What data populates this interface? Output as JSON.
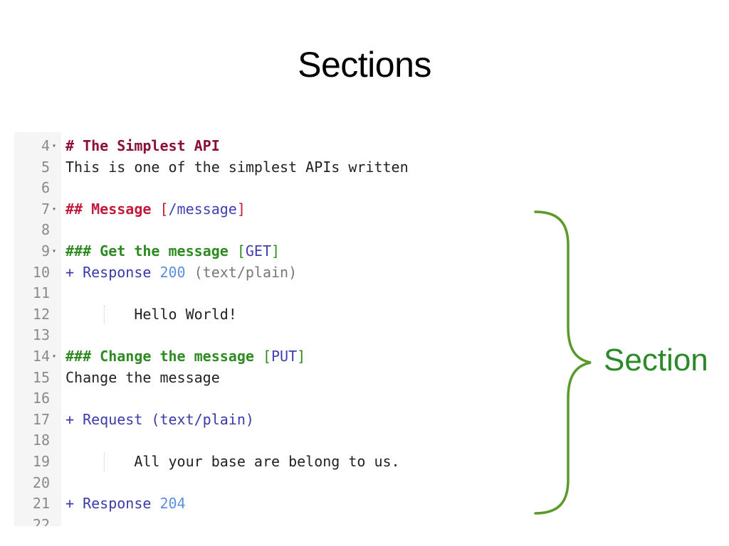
{
  "title": "Sections",
  "annotation": {
    "label": "Section",
    "brace_color": "#5a9a2a",
    "label_color": "#2a8a2a"
  },
  "lines": [
    {
      "num": "4",
      "fold": true,
      "segments": [
        {
          "t": "# The Simplest API",
          "c": "h1"
        }
      ]
    },
    {
      "num": "5",
      "fold": false,
      "segments": [
        {
          "t": "This is one of the simplest APIs written",
          "c": "plain"
        }
      ]
    },
    {
      "num": "6",
      "fold": false,
      "segments": []
    },
    {
      "num": "7",
      "fold": true,
      "segments": [
        {
          "t": "## Message ",
          "c": "h2"
        },
        {
          "t": "[",
          "c": "h2-url"
        },
        {
          "t": "/message",
          "c": "method"
        },
        {
          "t": "]",
          "c": "h2-url"
        }
      ]
    },
    {
      "num": "8",
      "fold": false,
      "segments": []
    },
    {
      "num": "9",
      "fold": true,
      "segments": [
        {
          "t": "### Get the message ",
          "c": "h3"
        },
        {
          "t": "[",
          "c": "bracket-green"
        },
        {
          "t": "GET",
          "c": "method"
        },
        {
          "t": "]",
          "c": "bracket-green"
        }
      ]
    },
    {
      "num": "10",
      "fold": false,
      "segments": [
        {
          "t": "+ Response ",
          "c": "plus"
        },
        {
          "t": "200",
          "c": "status"
        },
        {
          "t": " (text/plain)",
          "c": "ctype"
        }
      ]
    },
    {
      "num": "11",
      "fold": false,
      "segments": []
    },
    {
      "num": "12",
      "fold": false,
      "guide": true,
      "segments": [
        {
          "t": "        Hello World!",
          "c": "plain"
        }
      ]
    },
    {
      "num": "13",
      "fold": false,
      "segments": []
    },
    {
      "num": "14",
      "fold": true,
      "segments": [
        {
          "t": "### Change the message ",
          "c": "h3"
        },
        {
          "t": "[",
          "c": "bracket-green"
        },
        {
          "t": "PUT",
          "c": "method"
        },
        {
          "t": "]",
          "c": "bracket-green"
        }
      ]
    },
    {
      "num": "15",
      "fold": false,
      "segments": [
        {
          "t": "Change the message",
          "c": "plain"
        }
      ]
    },
    {
      "num": "16",
      "fold": false,
      "segments": []
    },
    {
      "num": "17",
      "fold": false,
      "segments": [
        {
          "t": "+ Request (text/plain)",
          "c": "plus"
        }
      ]
    },
    {
      "num": "18",
      "fold": false,
      "segments": []
    },
    {
      "num": "19",
      "fold": false,
      "guide": true,
      "segments": [
        {
          "t": "        All your base are belong to us.",
          "c": "plain"
        }
      ]
    },
    {
      "num": "20",
      "fold": false,
      "segments": []
    },
    {
      "num": "21",
      "fold": false,
      "segments": [
        {
          "t": "+ Response ",
          "c": "plus"
        },
        {
          "t": "204",
          "c": "status"
        }
      ]
    },
    {
      "num": "22",
      "fold": false,
      "segments": []
    }
  ]
}
